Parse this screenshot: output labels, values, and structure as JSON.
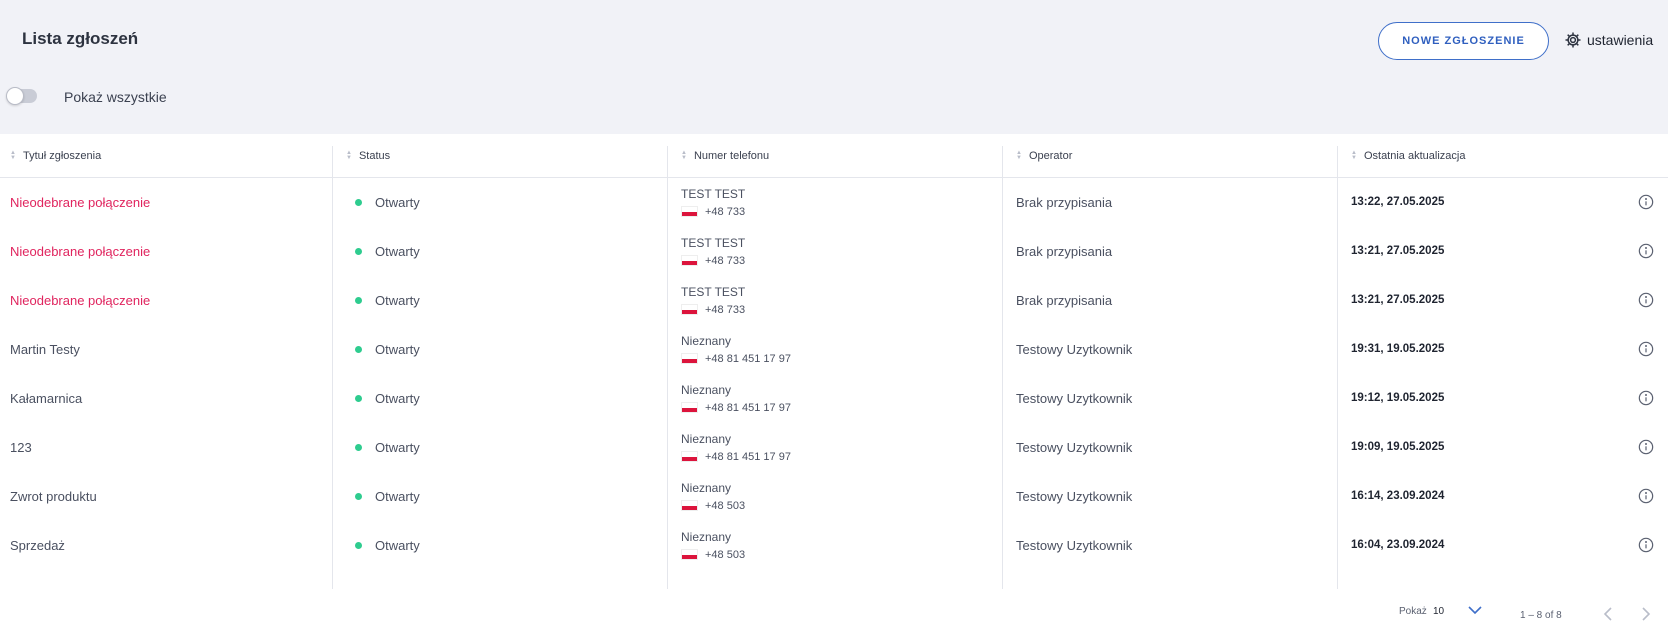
{
  "header": {
    "title": "Lista zgłoszeń",
    "new_button": "NOWE ZGŁOSZENIE",
    "settings_label": "ustawienia",
    "toggle_label": "Pokaż wszystkie",
    "toggle_on": false
  },
  "columns": [
    "Tytuł zgłoszenia",
    "Status",
    "Numer telefonu",
    "Operator",
    "Ostatnia aktualizacja"
  ],
  "rows": [
    {
      "title": "Nieodebrane połączenie",
      "missed": true,
      "status": "Otwarty",
      "caller": "TEST TEST",
      "phone": "+48 733",
      "operator": "Brak przypisania",
      "updated": "13:22, 27.05.2025"
    },
    {
      "title": "Nieodebrane połączenie",
      "missed": true,
      "status": "Otwarty",
      "caller": "TEST TEST",
      "phone": "+48 733",
      "operator": "Brak przypisania",
      "updated": "13:21, 27.05.2025"
    },
    {
      "title": "Nieodebrane połączenie",
      "missed": true,
      "status": "Otwarty",
      "caller": "TEST TEST",
      "phone": "+48 733",
      "operator": "Brak przypisania",
      "updated": "13:21, 27.05.2025"
    },
    {
      "title": "Martin Testy",
      "missed": false,
      "status": "Otwarty",
      "caller": "Nieznany",
      "phone": "+48 81 451 17 97",
      "operator": "Testowy Uzytkownik",
      "updated": "19:31, 19.05.2025"
    },
    {
      "title": "Kałamarnica",
      "missed": false,
      "status": "Otwarty",
      "caller": "Nieznany",
      "phone": "+48 81 451 17 97",
      "operator": "Testowy Uzytkownik",
      "updated": "19:12, 19.05.2025"
    },
    {
      "title": "123",
      "missed": false,
      "status": "Otwarty",
      "caller": "Nieznany",
      "phone": "+48 81 451 17 97",
      "operator": "Testowy Uzytkownik",
      "updated": "19:09, 19.05.2025"
    },
    {
      "title": "Zwrot produktu",
      "missed": false,
      "status": "Otwarty",
      "caller": "Nieznany",
      "phone": "+48 503",
      "operator": "Testowy Uzytkownik",
      "updated": "16:14, 23.09.2024"
    },
    {
      "title": "Sprzedaż",
      "missed": false,
      "status": "Otwarty",
      "caller": "Nieznany",
      "phone": "+48 503",
      "operator": "Testowy Uzytkownik",
      "updated": "16:04, 23.09.2024"
    }
  ],
  "pagination": {
    "show_label": "Pokaż",
    "page_size": "10",
    "range": "1 – 8 of 8"
  },
  "colors": {
    "accent": "#3f6fc9",
    "missed_title": "#e0245e",
    "status_open": "#2ecc8f",
    "header_bg": "#f1f2f7"
  },
  "icons": {
    "settings": "gear-icon",
    "row_action": "info-icon",
    "sort": "sort-icon",
    "flag": "poland-flag-icon"
  }
}
